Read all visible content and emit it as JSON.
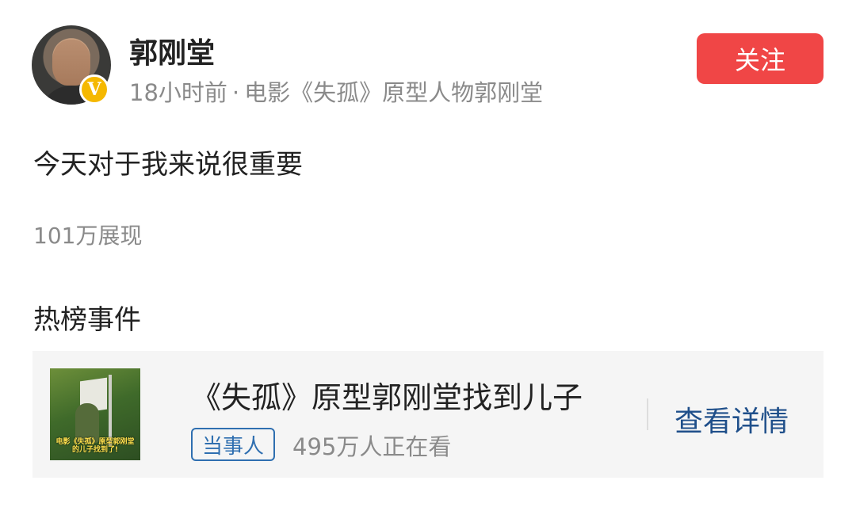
{
  "author": {
    "name": "郭刚堂",
    "time_ago": "18小时前",
    "separator": "·",
    "description": "电影《失孤》原型人物郭刚堂",
    "verified_badge": "V",
    "avatar_icon": "person-avatar"
  },
  "follow_button": {
    "label": "关注",
    "color": "#f04646"
  },
  "post": {
    "text": "今天对于我来说很重要",
    "views": "101万展现"
  },
  "hot_events": {
    "section_title": "热榜事件",
    "card": {
      "thumbnail_caption": "电影《失孤》原型郭刚堂的儿子找到了!",
      "title": "《失孤》原型郭刚堂找到儿子",
      "role_tag": "当事人",
      "watching": "495万人正在看",
      "detail_link": "查看详情",
      "link_color": "#1f4f8a"
    }
  }
}
